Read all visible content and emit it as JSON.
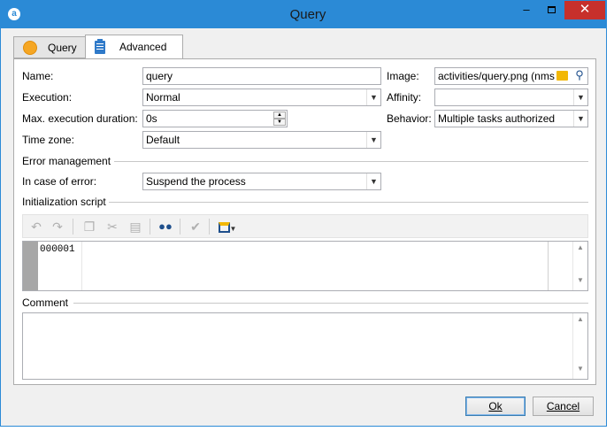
{
  "window": {
    "title": "Query",
    "app_icon": "adobe-campaign-icon",
    "controls": {
      "minimize": "–",
      "maximize": "",
      "close": "✕"
    }
  },
  "tabs": [
    {
      "label": "Query",
      "icon": "orange-circle-icon",
      "active": false
    },
    {
      "label": "Advanced",
      "icon": "clipboard-icon",
      "active": true
    }
  ],
  "form": {
    "name": {
      "label": "Name:",
      "value": "query"
    },
    "execution": {
      "label": "Execution:",
      "value": "Normal"
    },
    "max_duration": {
      "label": "Max. execution duration:",
      "value": "0s"
    },
    "time_zone": {
      "label": "Time zone:",
      "value": "Default"
    },
    "image": {
      "label": "Image:",
      "value": "activities/query.png (nms"
    },
    "affinity": {
      "label": "Affinity:",
      "value": ""
    },
    "behavior": {
      "label": "Behavior:",
      "value": "Multiple tasks authorized"
    }
  },
  "error_management": {
    "heading": "Error management",
    "in_case_of_error": {
      "label": "In case of error:",
      "value": "Suspend the process"
    }
  },
  "init_script": {
    "heading": "Initialization script",
    "toolbar_icons": [
      "undo-icon",
      "redo-icon",
      "copy-icon",
      "cut-icon",
      "paste-icon",
      "find-binoculars-icon",
      "check-icon",
      "insert-field-dropdown-icon"
    ],
    "line_number": "000001"
  },
  "comment": {
    "heading": "Comment",
    "value": ""
  },
  "buttons": {
    "ok": "Ok",
    "cancel": "Cancel"
  },
  "colors": {
    "titlebar": "#2b8ad6",
    "close": "#c7302b",
    "tab_icon_orange": "#f5a623"
  }
}
